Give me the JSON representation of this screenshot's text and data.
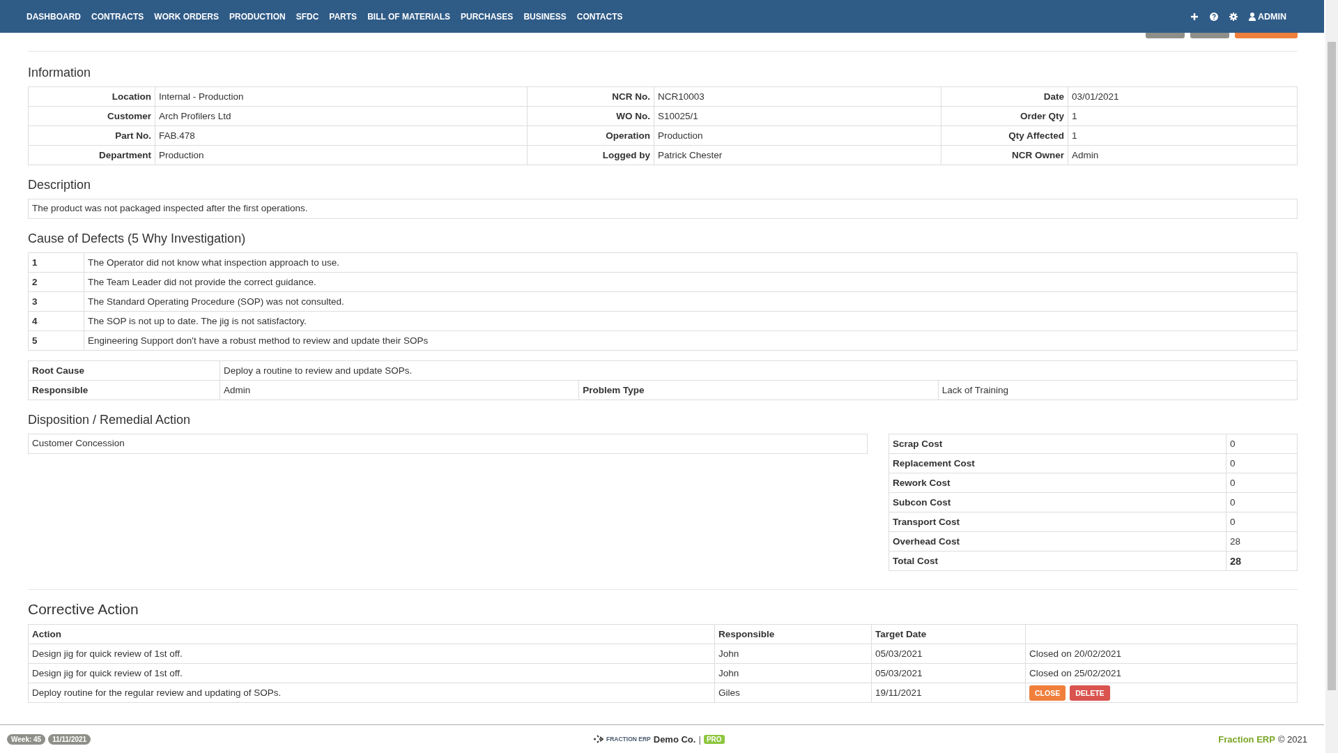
{
  "nav": {
    "items": [
      "DASHBOARD",
      "CONTRACTS",
      "WORK ORDERS",
      "PRODUCTION",
      "SFDC",
      "PARTS",
      "BILL OF MATERIALS",
      "PURCHASES",
      "BUSINESS",
      "CONTACTS"
    ],
    "user": "ADMIN"
  },
  "information": {
    "title": "Information",
    "rows": [
      [
        {
          "label": "Location",
          "value": "Internal - Production"
        },
        {
          "label": "NCR No.",
          "value": "NCR10003"
        },
        {
          "label": "Date",
          "value": "03/01/2021"
        }
      ],
      [
        {
          "label": "Customer",
          "value": "Arch Profilers Ltd"
        },
        {
          "label": "WO No.",
          "value": "S10025/1"
        },
        {
          "label": "Order Qty",
          "value": "1"
        }
      ],
      [
        {
          "label": "Part No.",
          "value": "FAB.478"
        },
        {
          "label": "Operation",
          "value": "Production"
        },
        {
          "label": "Qty Affected",
          "value": "1"
        }
      ],
      [
        {
          "label": "Department",
          "value": "Production"
        },
        {
          "label": "Logged by",
          "value": "Patrick Chester"
        },
        {
          "label": "NCR Owner",
          "value": "Admin"
        }
      ]
    ]
  },
  "description": {
    "title": "Description",
    "text": "The product was not packaged inspected after the first operations."
  },
  "cause": {
    "title": "Cause of Defects (5 Why Investigation)",
    "whys": [
      {
        "number": "1",
        "text": "The Operator did not know what inspection approach to use."
      },
      {
        "number": "2",
        "text": "The Team Leader did not provide the correct guidance."
      },
      {
        "number": "3",
        "text": "The Standard Operating Procedure (SOP) was not consulted."
      },
      {
        "number": "4",
        "text": "The SOP is not up to date. The jig is not satisfactory."
      },
      {
        "number": "5",
        "text": "Engineering Support don't have a robust method to review and update their SOPs"
      }
    ],
    "root_cause_label": "Root Cause",
    "root_cause": "Deploy a routine to review and update SOPs.",
    "responsible_label": "Responsible",
    "responsible": "Admin",
    "problem_type_label": "Problem Type",
    "problem_type": "Lack of Training"
  },
  "disposition": {
    "title": "Disposition / Remedial Action",
    "text": "Customer Concession",
    "costs": [
      {
        "label": "Scrap Cost",
        "value": "0",
        "total": false
      },
      {
        "label": "Replacement Cost",
        "value": "0",
        "total": false
      },
      {
        "label": "Rework Cost",
        "value": "0",
        "total": false
      },
      {
        "label": "Subcon Cost",
        "value": "0",
        "total": false
      },
      {
        "label": "Transport Cost",
        "value": "0",
        "total": false
      },
      {
        "label": "Overhead Cost",
        "value": "28",
        "total": false
      },
      {
        "label": "Total Cost",
        "value": "28",
        "total": true
      }
    ]
  },
  "corrective": {
    "title": "Corrective Action",
    "columns": [
      "Action",
      "Responsible",
      "Target Date"
    ],
    "rows": [
      {
        "action": "Design jig for quick review of 1st off.",
        "responsible": "John",
        "target_date": "05/03/2021",
        "kind": "closed",
        "status": "Closed on 20/02/2021"
      },
      {
        "action": "Design jig for quick review of 1st off.",
        "responsible": "John",
        "target_date": "05/03/2021",
        "kind": "closed",
        "status": "Closed on 25/02/2021"
      },
      {
        "action": "Deploy routine for the regular review and updating of SOPs.",
        "responsible": "Giles",
        "target_date": "19/11/2021",
        "kind": "open",
        "buttons": [
          "CLOSE",
          "DELETE"
        ]
      }
    ]
  },
  "footer": {
    "week": "Week: 45",
    "date": "11/11/2021",
    "brand": "FRACTION ERP",
    "company": "Demo Co.",
    "separator": "|",
    "edition": "PRO",
    "product": "Fraction ERP",
    "copyright": "© 2021"
  }
}
